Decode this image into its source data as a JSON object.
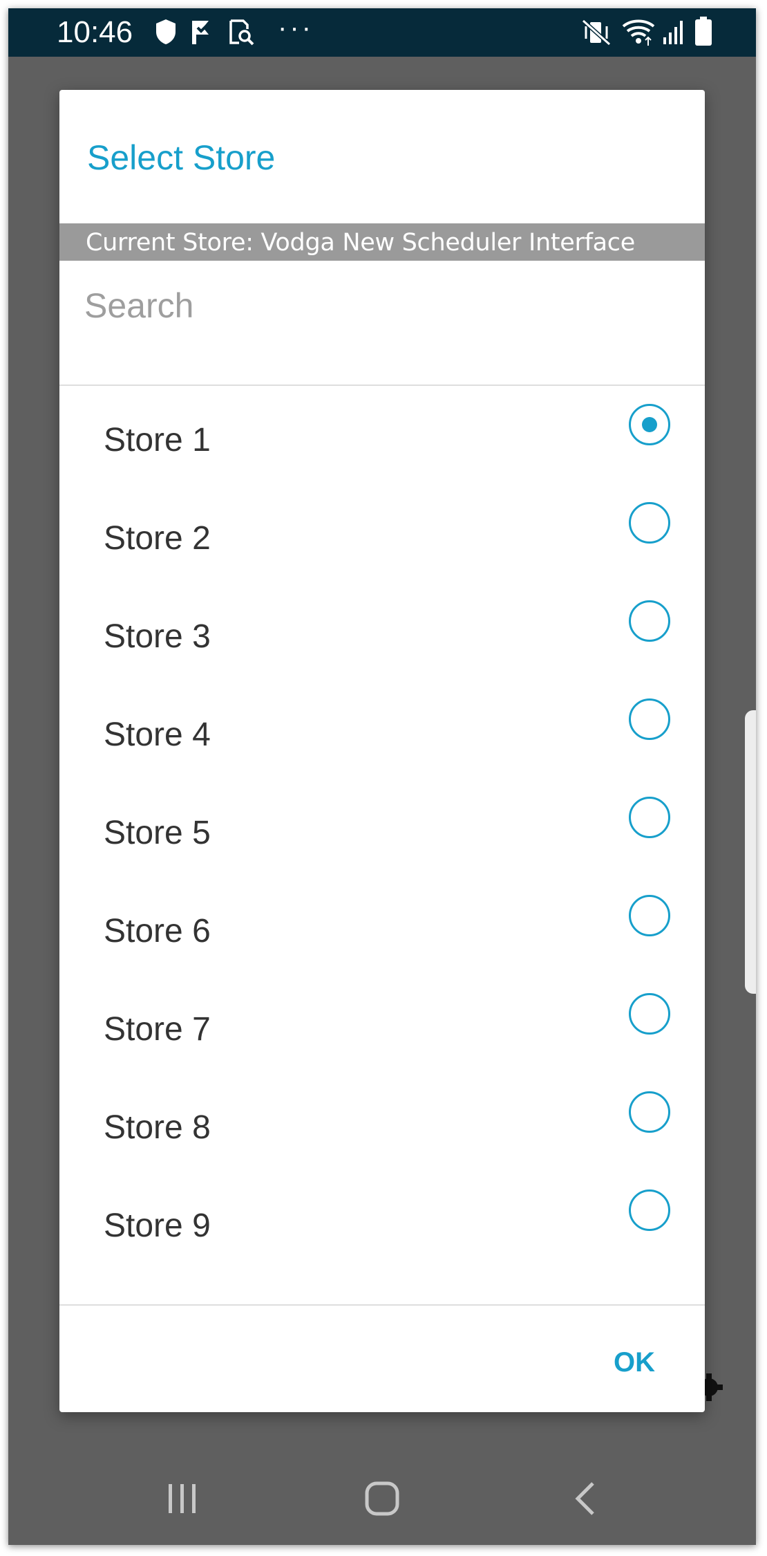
{
  "status_bar": {
    "time": "10:46",
    "more_label": "···",
    "left_icons": [
      "shield-icon",
      "check-flag-icon",
      "screenshot-search-icon"
    ],
    "right_icons": [
      "vibrate-mute-icon",
      "wifi-icon",
      "signal-icon",
      "battery-icon"
    ]
  },
  "dialog": {
    "title": "Select Store",
    "current_store": "Current Store: Vodga New Scheduler Interface",
    "search": {
      "placeholder": "Search",
      "value": ""
    },
    "stores": [
      {
        "label": "Store 1",
        "selected": true
      },
      {
        "label": "Store 2",
        "selected": false
      },
      {
        "label": "Store 3",
        "selected": false
      },
      {
        "label": "Store 4",
        "selected": false
      },
      {
        "label": "Store 5",
        "selected": false
      },
      {
        "label": "Store 6",
        "selected": false
      },
      {
        "label": "Store 7",
        "selected": false
      },
      {
        "label": "Store 8",
        "selected": false
      },
      {
        "label": "Store 9",
        "selected": false
      }
    ],
    "ok_label": "OK"
  },
  "nav_bar": {
    "icons": [
      "recent-apps-icon",
      "home-icon",
      "back-icon"
    ]
  },
  "colors": {
    "accent": "#179fcb",
    "status_bar": "#062a3a",
    "scrim": "#5f5f5f",
    "current_store_bg": "#9a9a9a"
  }
}
